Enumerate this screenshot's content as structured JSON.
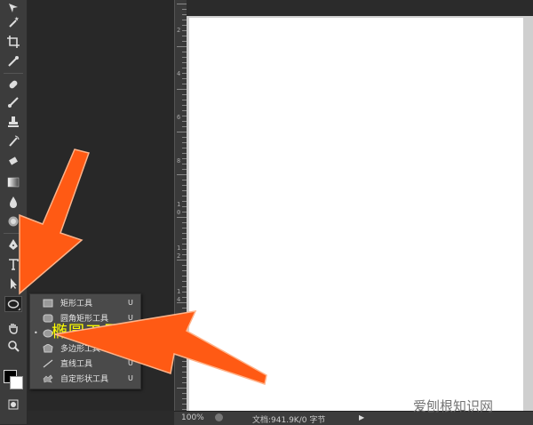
{
  "status": {
    "zoom": "100%",
    "doc_info": "文档:941.9K/0 字节"
  },
  "flyout": {
    "items": [
      {
        "label": "矩形工具",
        "key": "U"
      },
      {
        "label": "圆角矩形工具",
        "key": "U"
      },
      {
        "label": "椭圆工具",
        "key": "U"
      },
      {
        "label": "多边形工具",
        "key": "U"
      },
      {
        "label": "直线工具",
        "key": "U"
      },
      {
        "label": "自定形状工具",
        "key": "U"
      }
    ],
    "bullet": "•"
  },
  "callout": "椭圆工具",
  "ruler_numbers": [
    "2",
    "4",
    "6",
    "8",
    "1 0",
    "1 2",
    "1 4"
  ],
  "watermark": "爱刨根知识网",
  "colors": {
    "arrow": "#ff5a14",
    "callout": "#ffff00",
    "canvas": "#ffffff",
    "panel": "#2b2b2b"
  },
  "icons": [
    "move-icon",
    "magic-wand-icon",
    "crop-icon",
    "eyedropper-icon",
    "healing-brush-icon",
    "brush-icon",
    "clone-stamp-icon",
    "history-brush-icon",
    "eraser-icon",
    "gradient-icon",
    "blur-icon",
    "dodge-icon",
    "pen-icon",
    "type-icon",
    "path-selection-icon",
    "ellipse-icon",
    "hand-icon",
    "zoom-icon"
  ]
}
